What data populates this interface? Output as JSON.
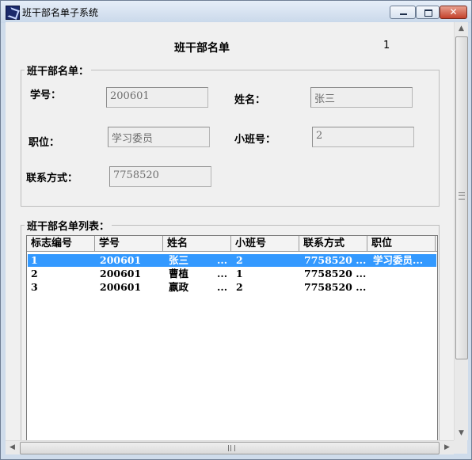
{
  "window": {
    "title": "班干部名单子系统",
    "close_glyph": "✕"
  },
  "header": {
    "title": "班干部名单",
    "record_no": "1"
  },
  "form": {
    "group_title": "班干部名单：",
    "student_id_label": "学号：",
    "student_id_value": "200601",
    "name_label": "姓名：",
    "name_value": "张三",
    "position_label": "职位：",
    "position_value": "学习委员",
    "class_no_label": "小班号：",
    "class_no_value": "2",
    "contact_label": "联系方式：",
    "contact_value": "7758520"
  },
  "list": {
    "group_title": "班干部名单列表：",
    "columns": [
      "标志编号",
      "学号",
      "姓名",
      "小班号",
      "联系方式",
      "职位"
    ],
    "rows": [
      {
        "id": "1",
        "student_id": "200601",
        "name": "张三",
        "name_more": "...",
        "class_no": "2",
        "contact": "7758520 ...",
        "position": "学习委员..."
      },
      {
        "id": "2",
        "student_id": "200601",
        "name": "曹植",
        "name_more": "...",
        "class_no": "1",
        "contact": "7758520 ...",
        "position": ""
      },
      {
        "id": "3",
        "student_id": "200601",
        "name": "嬴政",
        "name_more": "...",
        "class_no": "2",
        "contact": "7758520 ...",
        "position": ""
      }
    ],
    "selected_row": 0
  },
  "scroll": {
    "up": "▲",
    "down": "▼",
    "left": "◀",
    "right": "▶"
  },
  "colors": {
    "selection": "#3399ff",
    "close_button": "#c4412b"
  }
}
